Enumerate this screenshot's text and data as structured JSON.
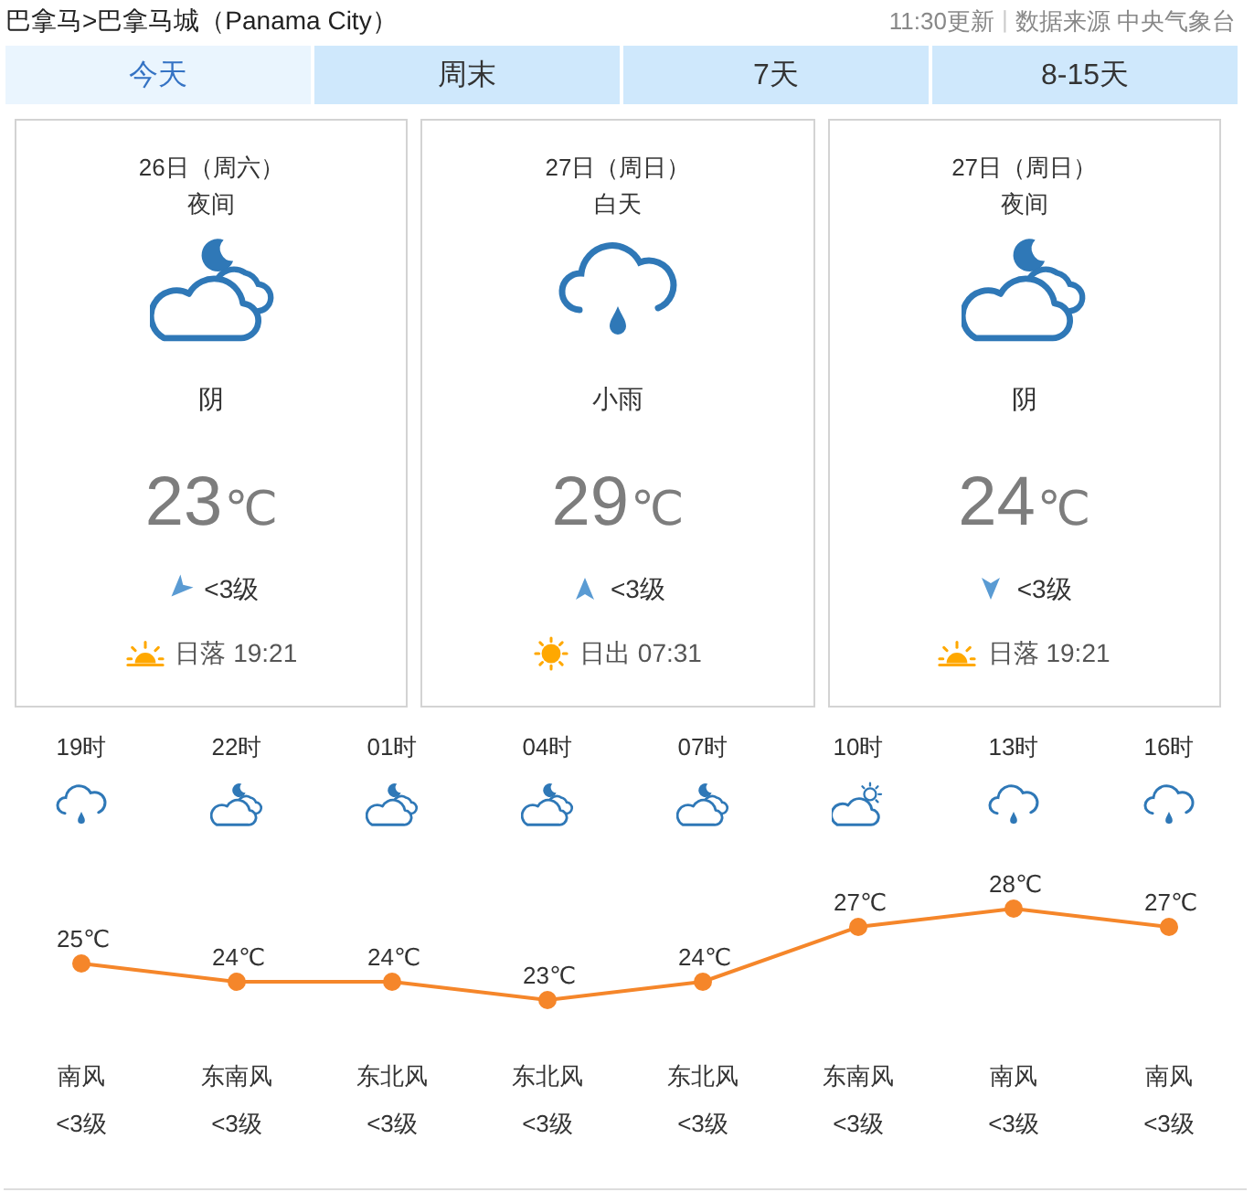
{
  "breadcrumb": "巴拿马>巴拿马城（Panama City）",
  "update_info": {
    "updated": "11:30更新",
    "separator": "|",
    "source": "数据来源 中央气象台"
  },
  "tabs": [
    {
      "label": "今天",
      "selected": true
    },
    {
      "label": "周末",
      "selected": false
    },
    {
      "label": "7天",
      "selected": false
    },
    {
      "label": "8-15天",
      "selected": false
    }
  ],
  "day_cards": [
    {
      "date": "26日（周六）",
      "period": "夜间",
      "weather": {
        "kind": "cloudy-night",
        "label": "阴"
      },
      "temperature": "23",
      "unit": "℃",
      "wind": {
        "kind": "down-left",
        "level": "<3级"
      },
      "sun": {
        "kind": "sunset",
        "text": "日落 19:21"
      }
    },
    {
      "date": "27日（周日）",
      "period": "白天",
      "weather": {
        "kind": "rain",
        "label": "小雨"
      },
      "temperature": "29",
      "unit": "℃",
      "wind": {
        "kind": "up",
        "level": "<3级"
      },
      "sun": {
        "kind": "sunrise",
        "text": "日出 07:31"
      }
    },
    {
      "date": "27日（周日）",
      "period": "夜间",
      "weather": {
        "kind": "cloudy-night",
        "label": "阴"
      },
      "temperature": "24",
      "unit": "℃",
      "wind": {
        "kind": "down",
        "level": "<3级"
      },
      "sun": {
        "kind": "sunset",
        "text": "日落 19:21"
      }
    }
  ],
  "hourly": {
    "hours": [
      {
        "time": "19时",
        "kind": "rain",
        "temperature_unit": "℃",
        "wind_direction": "南风",
        "wind_level": "<3级"
      },
      {
        "time": "22时",
        "kind": "cloudy-night",
        "temperature_unit": "℃",
        "wind_direction": "东南风",
        "wind_level": "<3级"
      },
      {
        "time": "01时",
        "kind": "cloudy-night",
        "temperature_unit": "℃",
        "wind_direction": "东北风",
        "wind_level": "<3级"
      },
      {
        "time": "04时",
        "kind": "cloudy-night",
        "temperature_unit": "℃",
        "wind_direction": "东北风",
        "wind_level": "<3级"
      },
      {
        "time": "07时",
        "kind": "cloudy-night",
        "temperature_unit": "℃",
        "wind_direction": "东北风",
        "wind_level": "<3级"
      },
      {
        "time": "10时",
        "kind": "cloudy-day",
        "temperature_unit": "℃",
        "wind_direction": "东南风",
        "wind_level": "<3级"
      },
      {
        "time": "13时",
        "kind": "rain",
        "temperature_unit": "℃",
        "wind_direction": "南风",
        "wind_level": "<3级"
      },
      {
        "time": "16时",
        "kind": "rain",
        "temperature_unit": "℃",
        "wind_direction": "南风",
        "wind_level": "<3级"
      }
    ],
    "chart_data": {
      "type": "line",
      "data_labels": true,
      "series": [
        {
          "color": "#f5862a",
          "marker": true,
          "values": [
            25,
            24,
            24,
            23,
            24,
            27,
            28,
            27
          ]
        }
      ]
    }
  }
}
